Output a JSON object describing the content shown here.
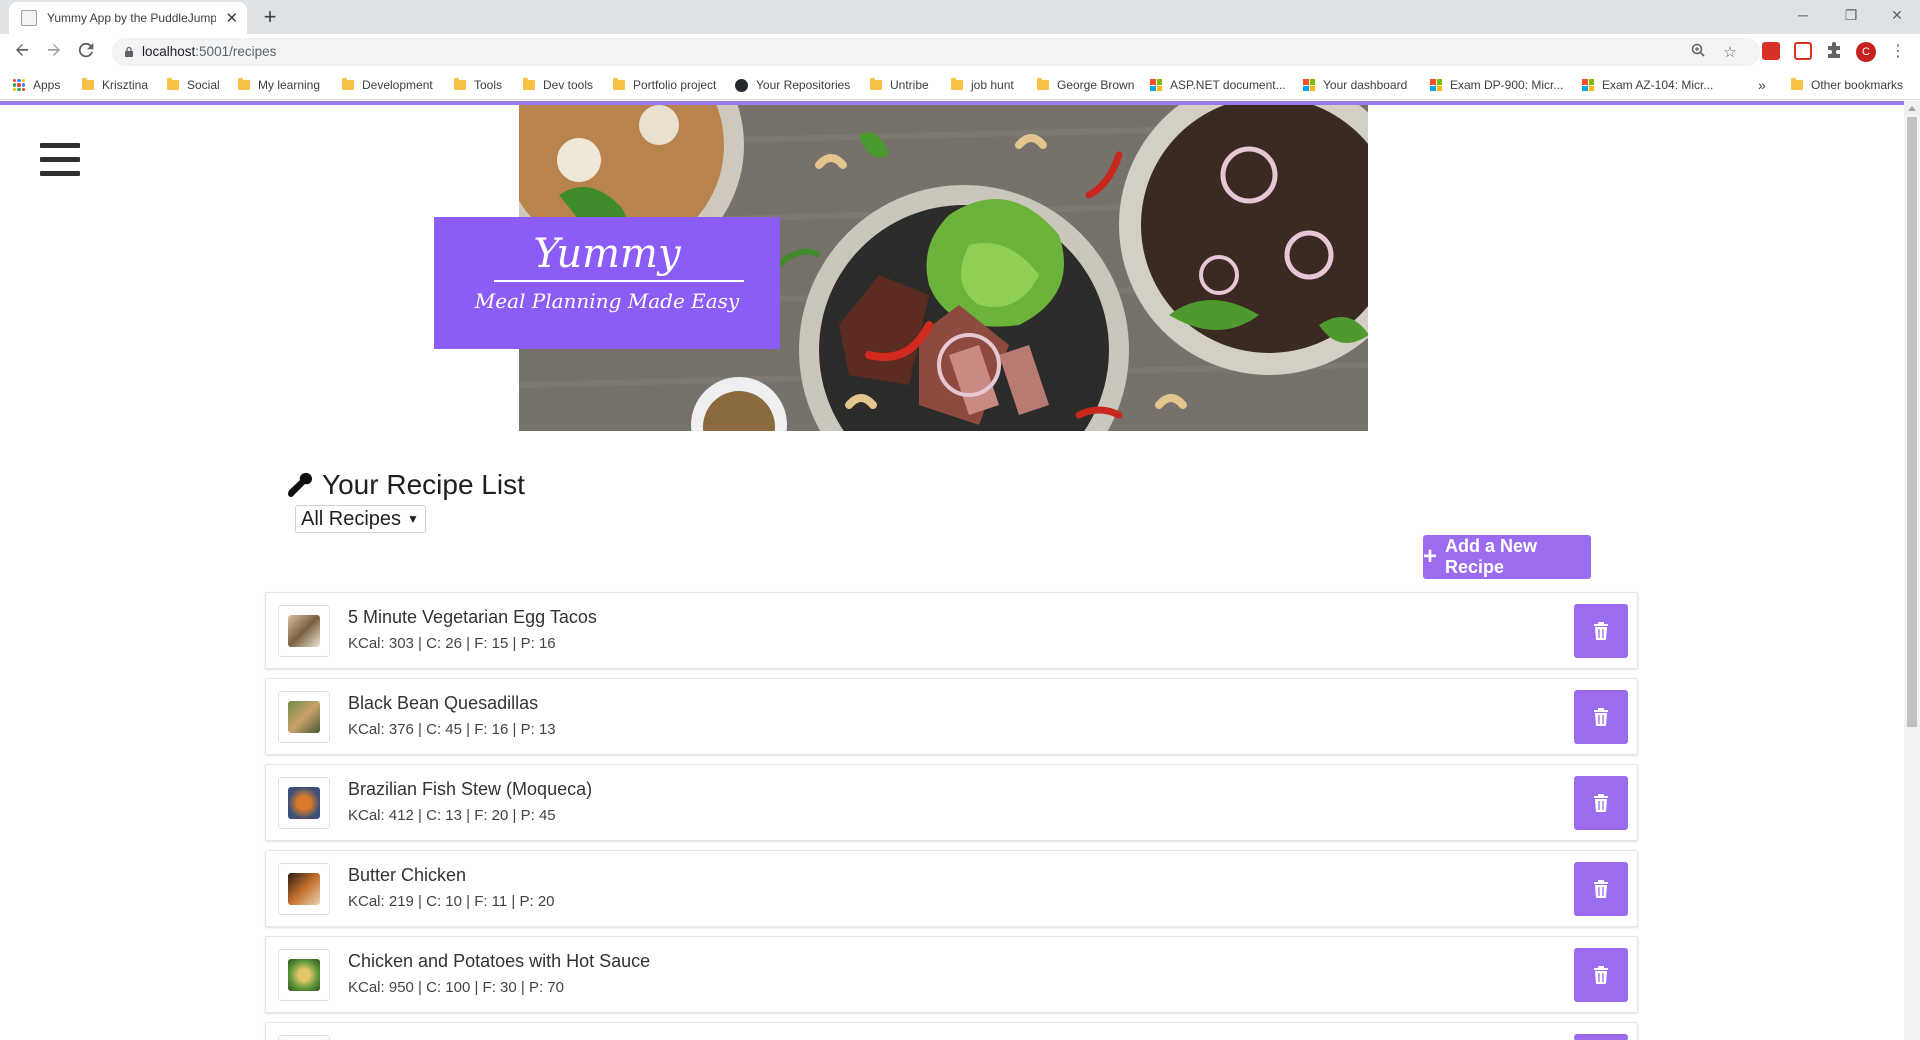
{
  "browser": {
    "tab_title": "Yummy App by the PuddleJumpers",
    "tab_close": "✕",
    "new_tab": "+",
    "url_host": "localhost",
    "url_path": ":5001/recipes",
    "window_controls": {
      "minimize": "─",
      "restore": "❐",
      "close": "✕"
    },
    "avatar_letter": "C",
    "bookmarks": [
      {
        "label": "Apps",
        "icon": "apps-icon"
      },
      {
        "label": "Krisztina",
        "icon": "folder-icon"
      },
      {
        "label": "Social",
        "icon": "folder-icon"
      },
      {
        "label": "My learning",
        "icon": "folder-icon"
      },
      {
        "label": "Development",
        "icon": "folder-icon"
      },
      {
        "label": "Tools",
        "icon": "folder-icon"
      },
      {
        "label": "Dev tools",
        "icon": "folder-icon"
      },
      {
        "label": "Portfolio project",
        "icon": "folder-icon"
      },
      {
        "label": "Your Repositories",
        "icon": "github-icon"
      },
      {
        "label": "Untribe",
        "icon": "folder-icon"
      },
      {
        "label": "job hunt",
        "icon": "folder-icon"
      },
      {
        "label": "George Brown",
        "icon": "folder-icon"
      },
      {
        "label": "ASP.NET document...",
        "icon": "microsoft-icon"
      },
      {
        "label": "Your dashboard",
        "icon": "microsoft-icon"
      },
      {
        "label": "Exam DP-900: Micr...",
        "icon": "microsoft-icon"
      },
      {
        "label": "Exam AZ-104: Micr...",
        "icon": "microsoft-icon"
      }
    ],
    "bookmarks_overflow": "»",
    "other_bookmarks": "Other bookmarks"
  },
  "hero": {
    "brand": "Yummy",
    "tagline": "Meal Planning Made Easy"
  },
  "recipes_page": {
    "title": "Your Recipe List",
    "filter_value": "All Recipes",
    "add_button_label": "Add a New Recipe",
    "recipes": [
      {
        "name": "5 Minute Vegetarian Egg Tacos",
        "macros": "KCal: 303 | C: 26 | F: 15 | P: 16"
      },
      {
        "name": "Black Bean Quesadillas",
        "macros": "KCal: 376 | C: 45 | F: 16 | P: 13"
      },
      {
        "name": "Brazilian Fish Stew (Moqueca)",
        "macros": "KCal: 412 | C: 13 | F: 20 | P: 45"
      },
      {
        "name": "Butter Chicken",
        "macros": "KCal: 219 | C: 10 | F: 11 | P: 20"
      },
      {
        "name": "Chicken and Potatoes with Hot Sauce",
        "macros": "KCal: 950 | C: 100 | F: 30 | P: 70"
      }
    ]
  },
  "colors": {
    "accent": "#8b5cf6",
    "button": "#9b6cf0",
    "accent_line": "#9b7bea"
  }
}
